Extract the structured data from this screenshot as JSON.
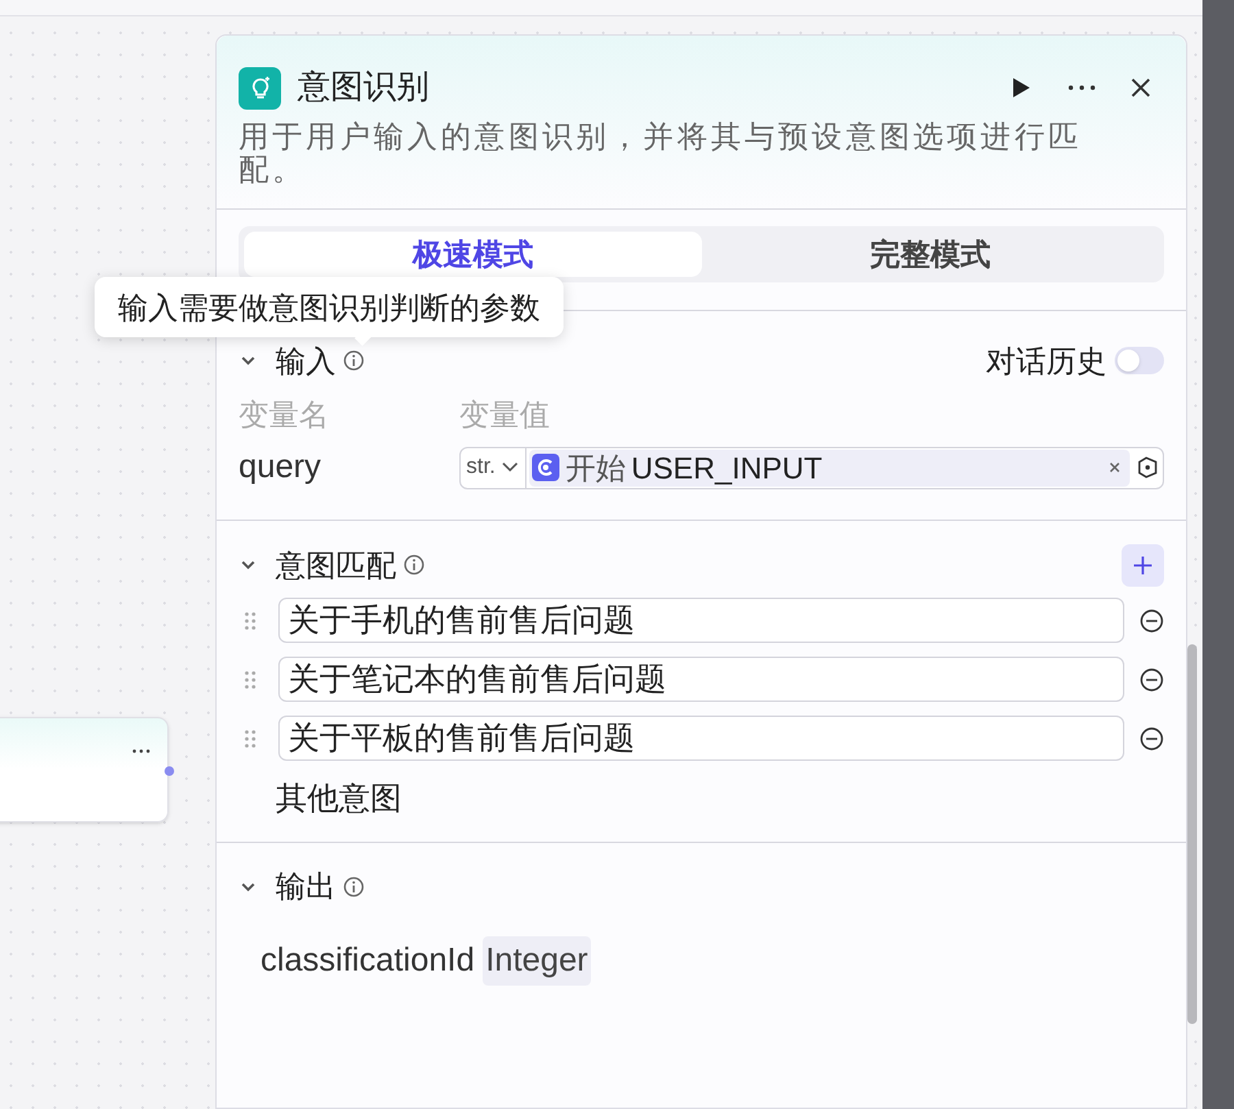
{
  "panel": {
    "title": "意图识别",
    "description": "用于用户输入的意图识别，并将其与预设意图选项进行匹配。"
  },
  "tabs": [
    {
      "label": "极速模式",
      "selected": true
    },
    {
      "label": "完整模式",
      "selected": false
    }
  ],
  "tooltip": "输入需要做意图识别判断的参数",
  "input_section": {
    "title": "输入",
    "expanded": true,
    "history_toggle": {
      "label": "对话历史",
      "on": false
    },
    "columns": [
      "变量名",
      "变量值"
    ],
    "variables": [
      {
        "name": "query",
        "type": "str.",
        "source_node": "开始",
        "source_var": "USER_INPUT"
      }
    ]
  },
  "intent_section": {
    "title": "意图匹配",
    "expanded": true,
    "intents": [
      "关于手机的售前售后问题",
      "关于笔记本的售前售后问题",
      "关于平板的售前售后问题"
    ],
    "other": "其他意图"
  },
  "output_section": {
    "title": "输出",
    "expanded": true,
    "outputs": [
      {
        "name": "classificationId",
        "type": "Integer"
      }
    ]
  }
}
